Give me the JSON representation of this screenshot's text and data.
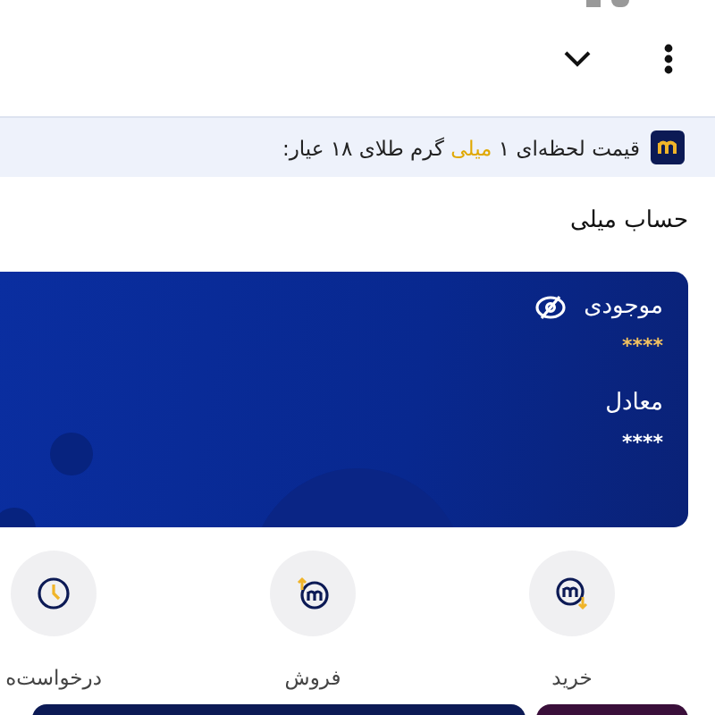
{
  "price_banner": {
    "before": "قیمت لحظه‌ای ۱",
    "highlight": "میلی",
    "after": "گرم طلای ۱۸ عیار:"
  },
  "account": {
    "title": "حساب میلی",
    "balance_label": "موجودی",
    "balance_value": "****",
    "equivalent_label": "معادل",
    "equivalent_value": "****"
  },
  "actions": [
    {
      "kind": "buy",
      "label": "خرید"
    },
    {
      "kind": "sell",
      "label": "فروش"
    },
    {
      "kind": "requests",
      "label": "درخواست‌ه"
    }
  ]
}
